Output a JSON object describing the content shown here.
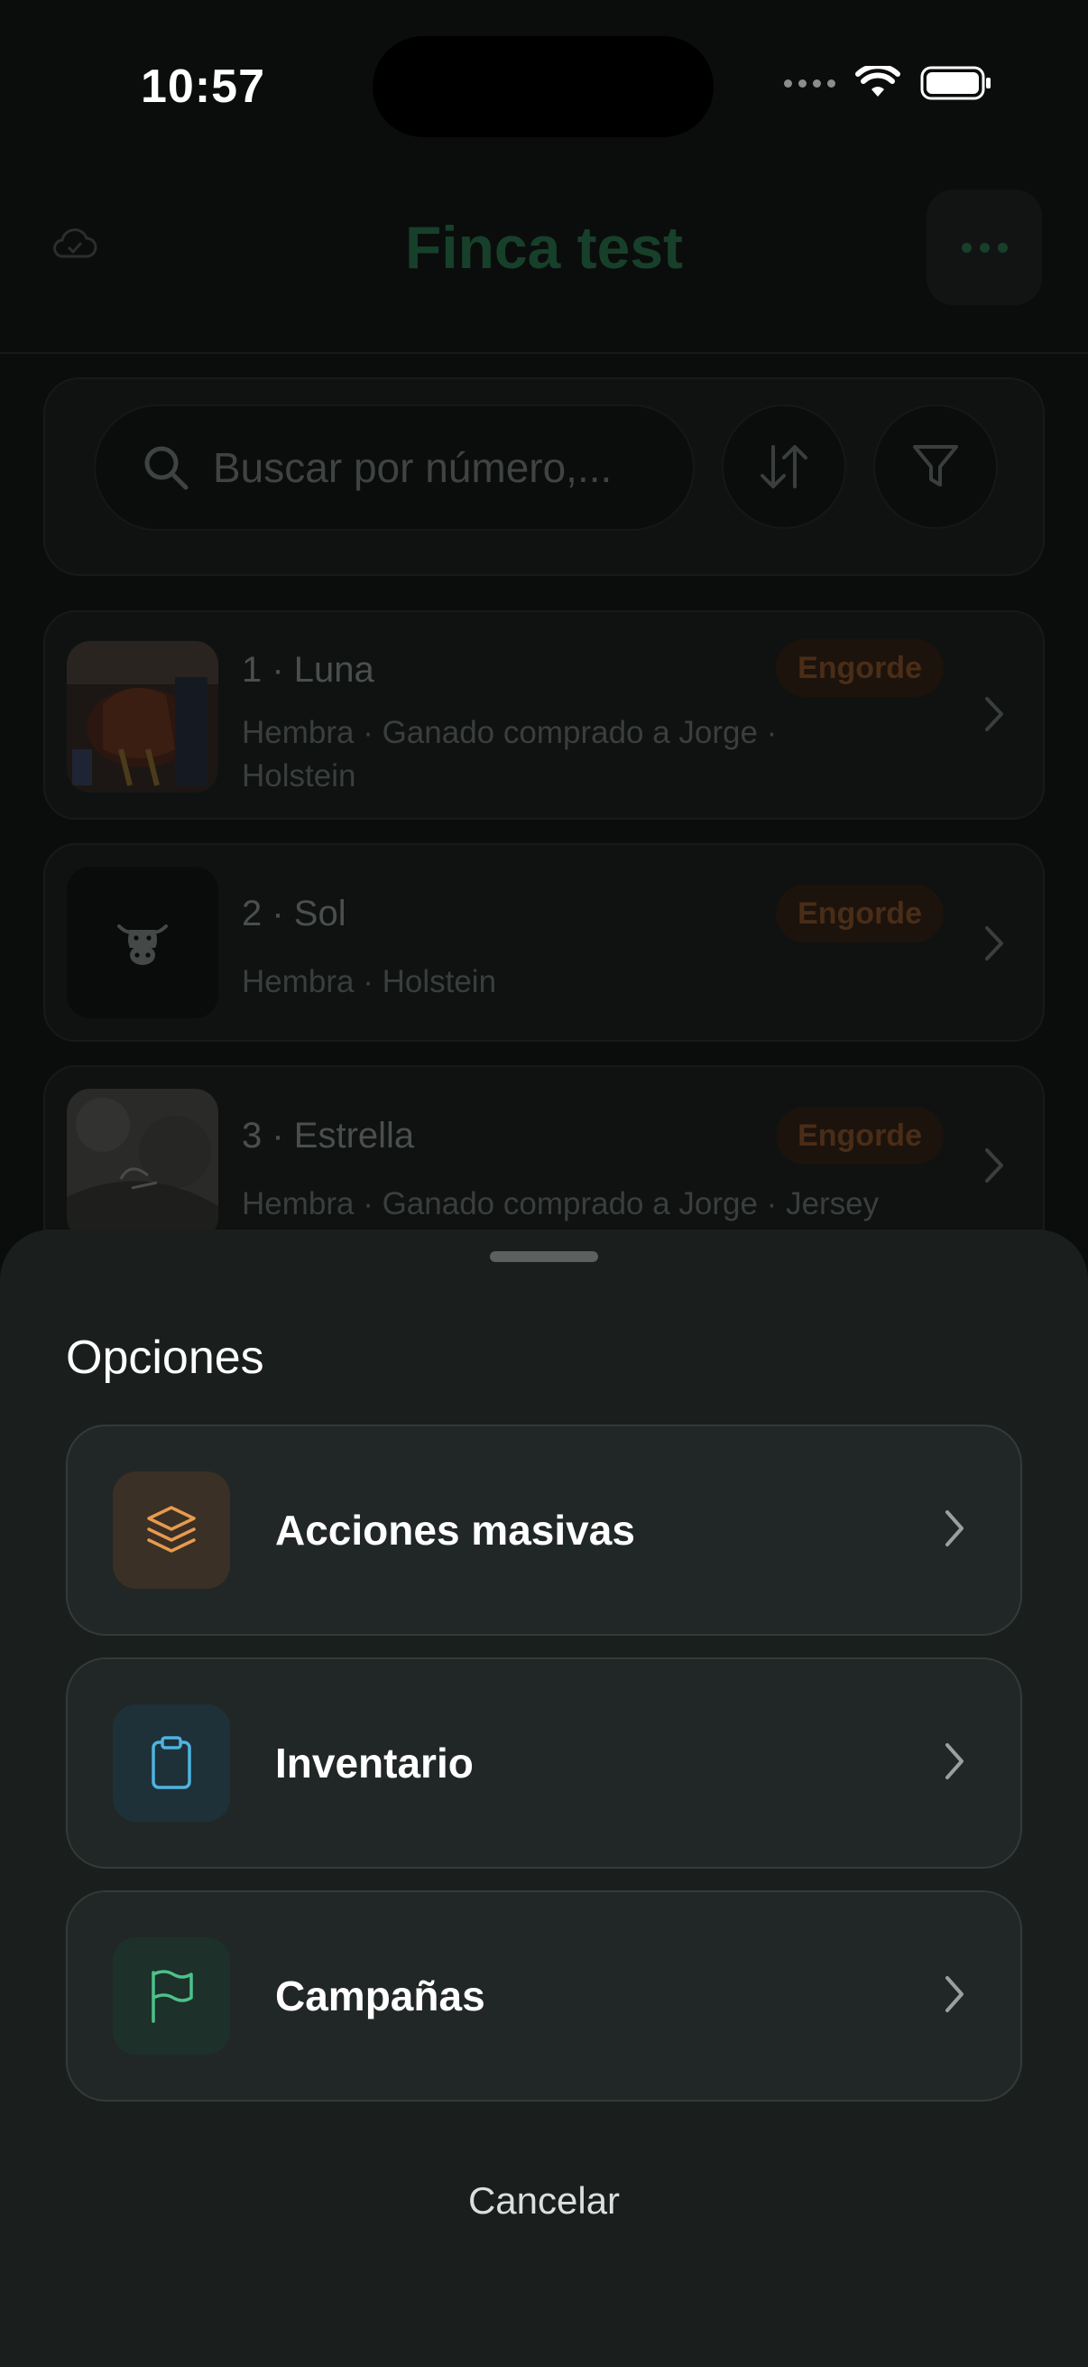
{
  "status_bar": {
    "time": "10:57"
  },
  "header": {
    "title": "Finca test"
  },
  "search": {
    "placeholder": "Buscar por número,..."
  },
  "animals": [
    {
      "name": "1 · Luna",
      "badge": "Engorde",
      "description": "Hembra · Ganado comprado a Jorge · Holstein",
      "photo": "horse-photo"
    },
    {
      "name": "2 · Sol",
      "badge": "Engorde",
      "description": "Hembra · Holstein",
      "photo": "cow-icon"
    },
    {
      "name": "3 · Estrella",
      "badge": "Engorde",
      "description": "Hembra · Ganado comprado a Jorge · Jersey",
      "photo": "hide-photo"
    }
  ],
  "sheet": {
    "title": "Opciones",
    "options": [
      {
        "label": "Acciones masivas",
        "icon": "layers-icon",
        "color": "#e89a4e"
      },
      {
        "label": "Inventario",
        "icon": "clipboard-icon",
        "color": "#4fb3e0"
      },
      {
        "label": "Campañas",
        "icon": "flag-icon",
        "color": "#4cc28a"
      }
    ],
    "cancel_label": "Cancelar"
  },
  "colors": {
    "brand_green": "#17402b",
    "badge_orange": "#4a2d17",
    "sheet_bg": "#1a1e1d"
  }
}
